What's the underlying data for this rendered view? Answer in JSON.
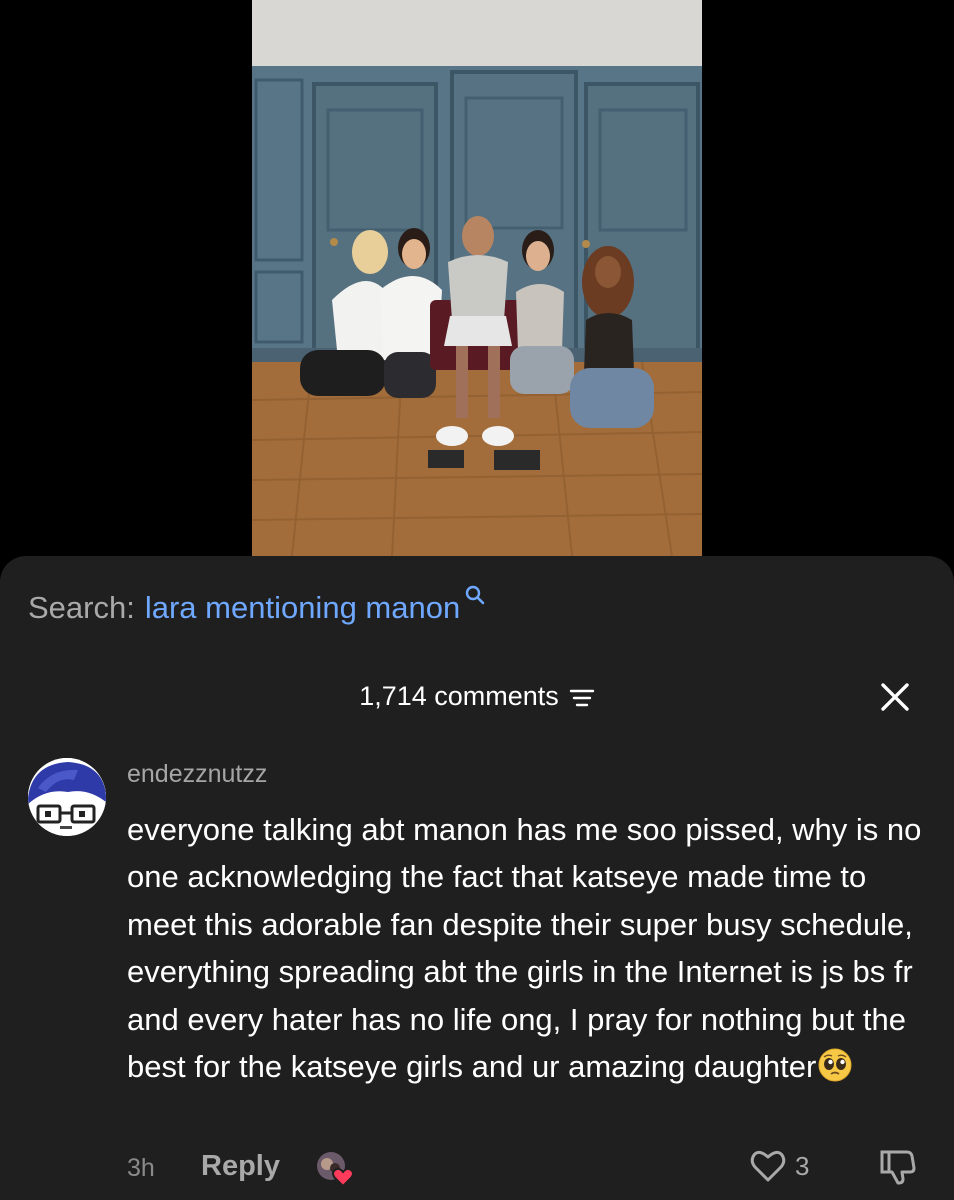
{
  "search": {
    "label": "Search:",
    "query": "lara mentioning manon"
  },
  "comments": {
    "count_label": "1,714 comments"
  },
  "comment": {
    "username": "endezznutzz",
    "text": "everyone talking abt manon has me soo pissed, why is no one acknowledging the fact that katseye made time to meet this adorable fan despite their super busy schedule, everything spreading abt the girls in the Internet is js bs fr and every hater has no life ong, I pray for nothing but the best for the katseye girls and ur amazing daughter",
    "emoji": "pleading-face-emoji",
    "time": "3h",
    "reply_label": "Reply",
    "like_count": "3"
  },
  "icons": [
    "search-icon",
    "sort-icon",
    "close-icon",
    "heart-icon",
    "dislike-icon",
    "creator-liked-icon"
  ],
  "colors": {
    "sheet_bg": "#1f1f1f",
    "search_query": "#6fa8ff",
    "muted_text": "#a9a9a9"
  }
}
